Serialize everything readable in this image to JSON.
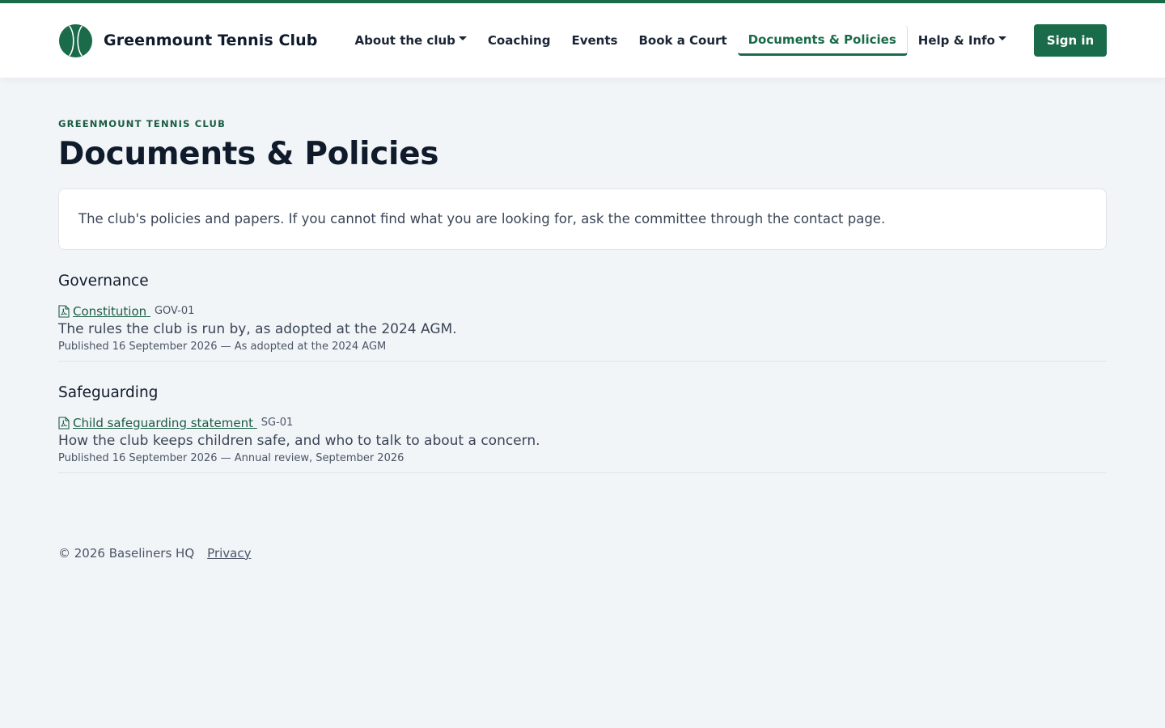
{
  "colors": {
    "brand": "#1a6b4a",
    "page_bg": "#f2f5f8",
    "text": "#0f1a2b"
  },
  "header": {
    "brand_name": "Greenmount Tennis Club",
    "logo_icon": "tennis-ball-icon",
    "nav": [
      {
        "label": "About the club",
        "dropdown": true
      },
      {
        "label": "Coaching",
        "dropdown": false
      },
      {
        "label": "Events",
        "dropdown": false
      },
      {
        "label": "Book a Court",
        "dropdown": false
      },
      {
        "label": "Documents & Policies",
        "dropdown": false,
        "active": true
      },
      {
        "label": "Help & Info",
        "dropdown": true
      }
    ],
    "sign_in_label": "Sign in"
  },
  "main": {
    "eyebrow": "Greenmount Tennis Club",
    "title": "Documents & Policies",
    "intro": "The club's policies and papers. If you cannot find what you are looking for, ask the committee through the contact page.",
    "sections": [
      {
        "heading": "Governance",
        "documents": [
          {
            "title": "Constitution",
            "code": "GOV-01",
            "icon": "pdf-file-icon",
            "description": "The rules the club is run by, as adopted at the 2024 AGM.",
            "meta": "Published 16 September 2026 — As adopted at the 2024 AGM"
          }
        ]
      },
      {
        "heading": "Safeguarding",
        "documents": [
          {
            "title": "Child safeguarding statement",
            "code": "SG-01",
            "icon": "pdf-file-icon",
            "description": "How the club keeps children safe, and who to talk to about a concern.",
            "meta": "Published 16 September 2026 — Annual review, September 2026"
          }
        ]
      }
    ]
  },
  "footer": {
    "copyright": "© 2026 Baseliners HQ",
    "privacy_label": "Privacy"
  }
}
